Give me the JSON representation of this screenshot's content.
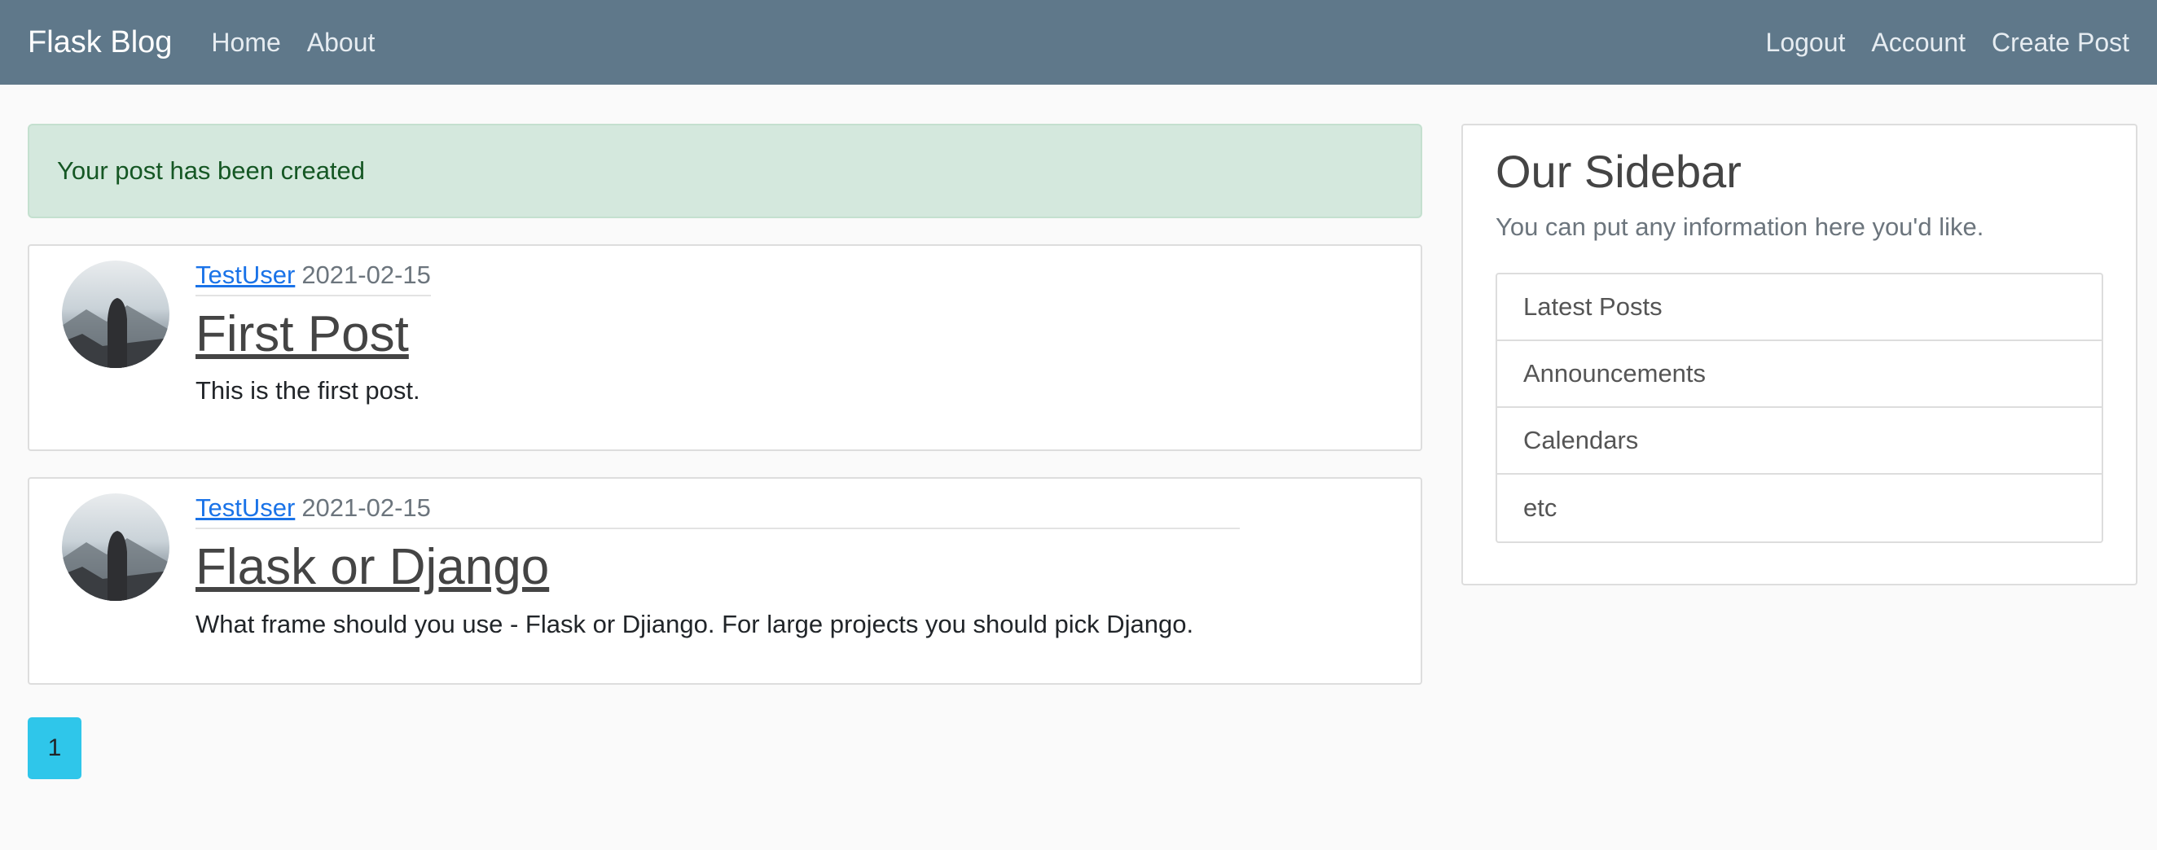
{
  "navbar": {
    "brand": "Flask Blog",
    "left_links": [
      {
        "label": "Home"
      },
      {
        "label": "About"
      }
    ],
    "right_links": [
      {
        "label": "Logout"
      },
      {
        "label": "Account"
      },
      {
        "label": "Create Post"
      }
    ]
  },
  "alert": {
    "message": "Your post has been created"
  },
  "posts": [
    {
      "author": "TestUser",
      "date": "2021-02-15",
      "title": "First Post",
      "content": "This is the first post."
    },
    {
      "author": "TestUser",
      "date": "2021-02-15",
      "title": "Flask or Django",
      "content": "What frame should you use - Flask or Djiango. For large projects you should pick Django."
    }
  ],
  "pagination": {
    "current_page": "1"
  },
  "sidebar": {
    "title": "Our Sidebar",
    "subtitle": "You can put any information here you'd like.",
    "items": [
      {
        "label": "Latest Posts"
      },
      {
        "label": "Announcements"
      },
      {
        "label": "Calendars"
      },
      {
        "label": "etc"
      }
    ]
  },
  "colors": {
    "navbar_bg": "#5f788a",
    "alert_bg": "#d4e8dd",
    "alert_text": "#155724",
    "link": "#1a73e8",
    "page_button": "#2fc6ea"
  }
}
